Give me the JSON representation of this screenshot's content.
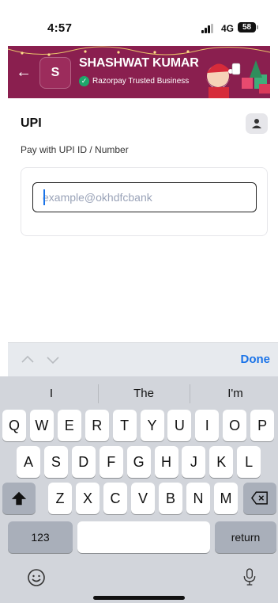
{
  "status": {
    "time": "4:57",
    "network": "4G",
    "battery": "58"
  },
  "header": {
    "initial": "S",
    "merchant_name": "SHASHWAT KUMAR",
    "trusted_label": "Razorpay Trusted Business"
  },
  "upi": {
    "title": "UPI",
    "subtitle": "Pay with UPI ID / Number",
    "input_placeholder": "example@okhdfcbank",
    "input_value": ""
  },
  "keyboard": {
    "done_label": "Done",
    "suggestions": [
      "I",
      "The",
      "I'm"
    ],
    "row1": [
      "Q",
      "W",
      "E",
      "R",
      "T",
      "Y",
      "U",
      "I",
      "O",
      "P"
    ],
    "row2": [
      "A",
      "S",
      "D",
      "F",
      "G",
      "H",
      "J",
      "K",
      "L"
    ],
    "row3": [
      "Z",
      "X",
      "C",
      "V",
      "B",
      "N",
      "M"
    ],
    "numbers_label": "123",
    "space_label": "",
    "return_label": "return"
  },
  "colors": {
    "header_bg": "#8a1f4f",
    "accent": "#1a73e8",
    "trusted_green": "#1ea86b"
  },
  "icons": [
    "back-arrow-icon",
    "verified-check-icon",
    "santa-illustration-icon",
    "contact-person-icon",
    "chevron-up-icon",
    "chevron-down-icon",
    "shift-icon",
    "delete-icon",
    "emoji-icon",
    "microphone-icon"
  ]
}
